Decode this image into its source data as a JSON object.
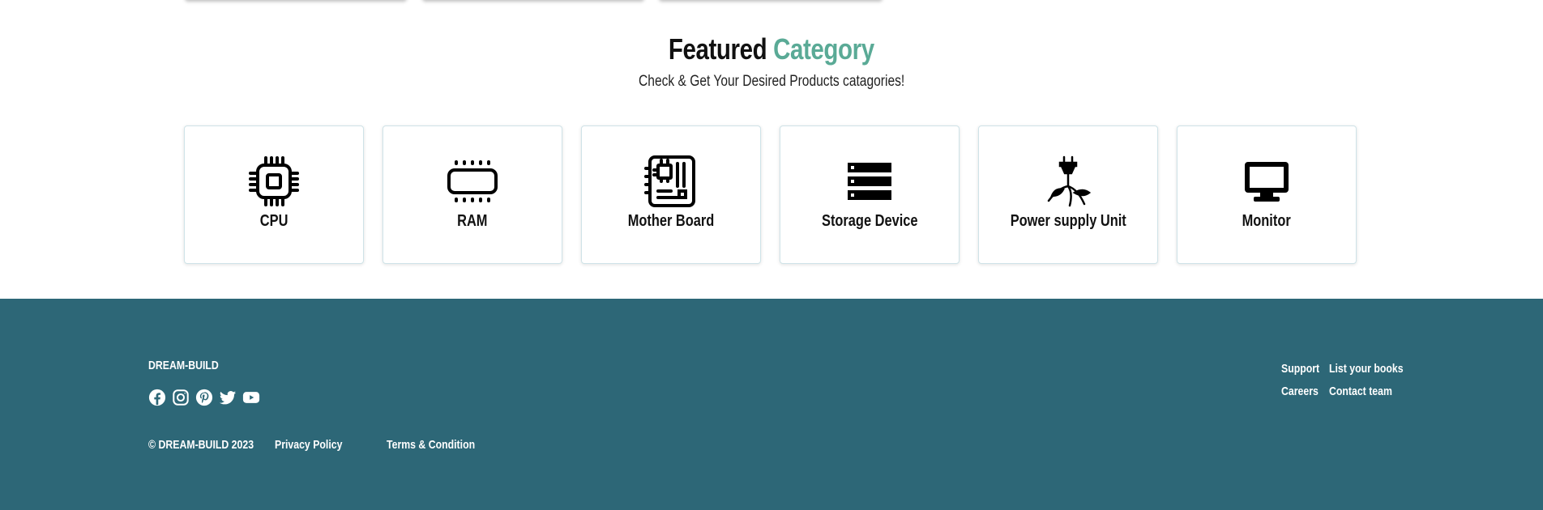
{
  "section": {
    "title_main": "Featured",
    "title_accent": "Category",
    "subtitle": "Check & Get Your Desired Products catagories!",
    "accent_color": "#5aaa96"
  },
  "categories": [
    {
      "label": "CPU",
      "icon": "cpu-icon"
    },
    {
      "label": "RAM",
      "icon": "ram-icon"
    },
    {
      "label": "Mother Board",
      "icon": "motherboard-icon"
    },
    {
      "label": "Storage Device",
      "icon": "storage-icon"
    },
    {
      "label": "Power supply Unit",
      "icon": "power-plug-icon"
    },
    {
      "label": "Monitor",
      "icon": "monitor-icon"
    }
  ],
  "footer": {
    "brand": "DREAM-BUILD",
    "background": "#2d6777",
    "socials": [
      "facebook-icon",
      "instagram-icon",
      "pinterest-icon",
      "twitter-icon",
      "youtube-icon"
    ],
    "copyright": "© DREAM-BUILD 2023",
    "privacy": "Privacy Policy",
    "terms": "Terms & Condition",
    "links": {
      "support": "Support",
      "list_books": "List your books",
      "careers": "Careers",
      "contact": "Contact team"
    }
  }
}
